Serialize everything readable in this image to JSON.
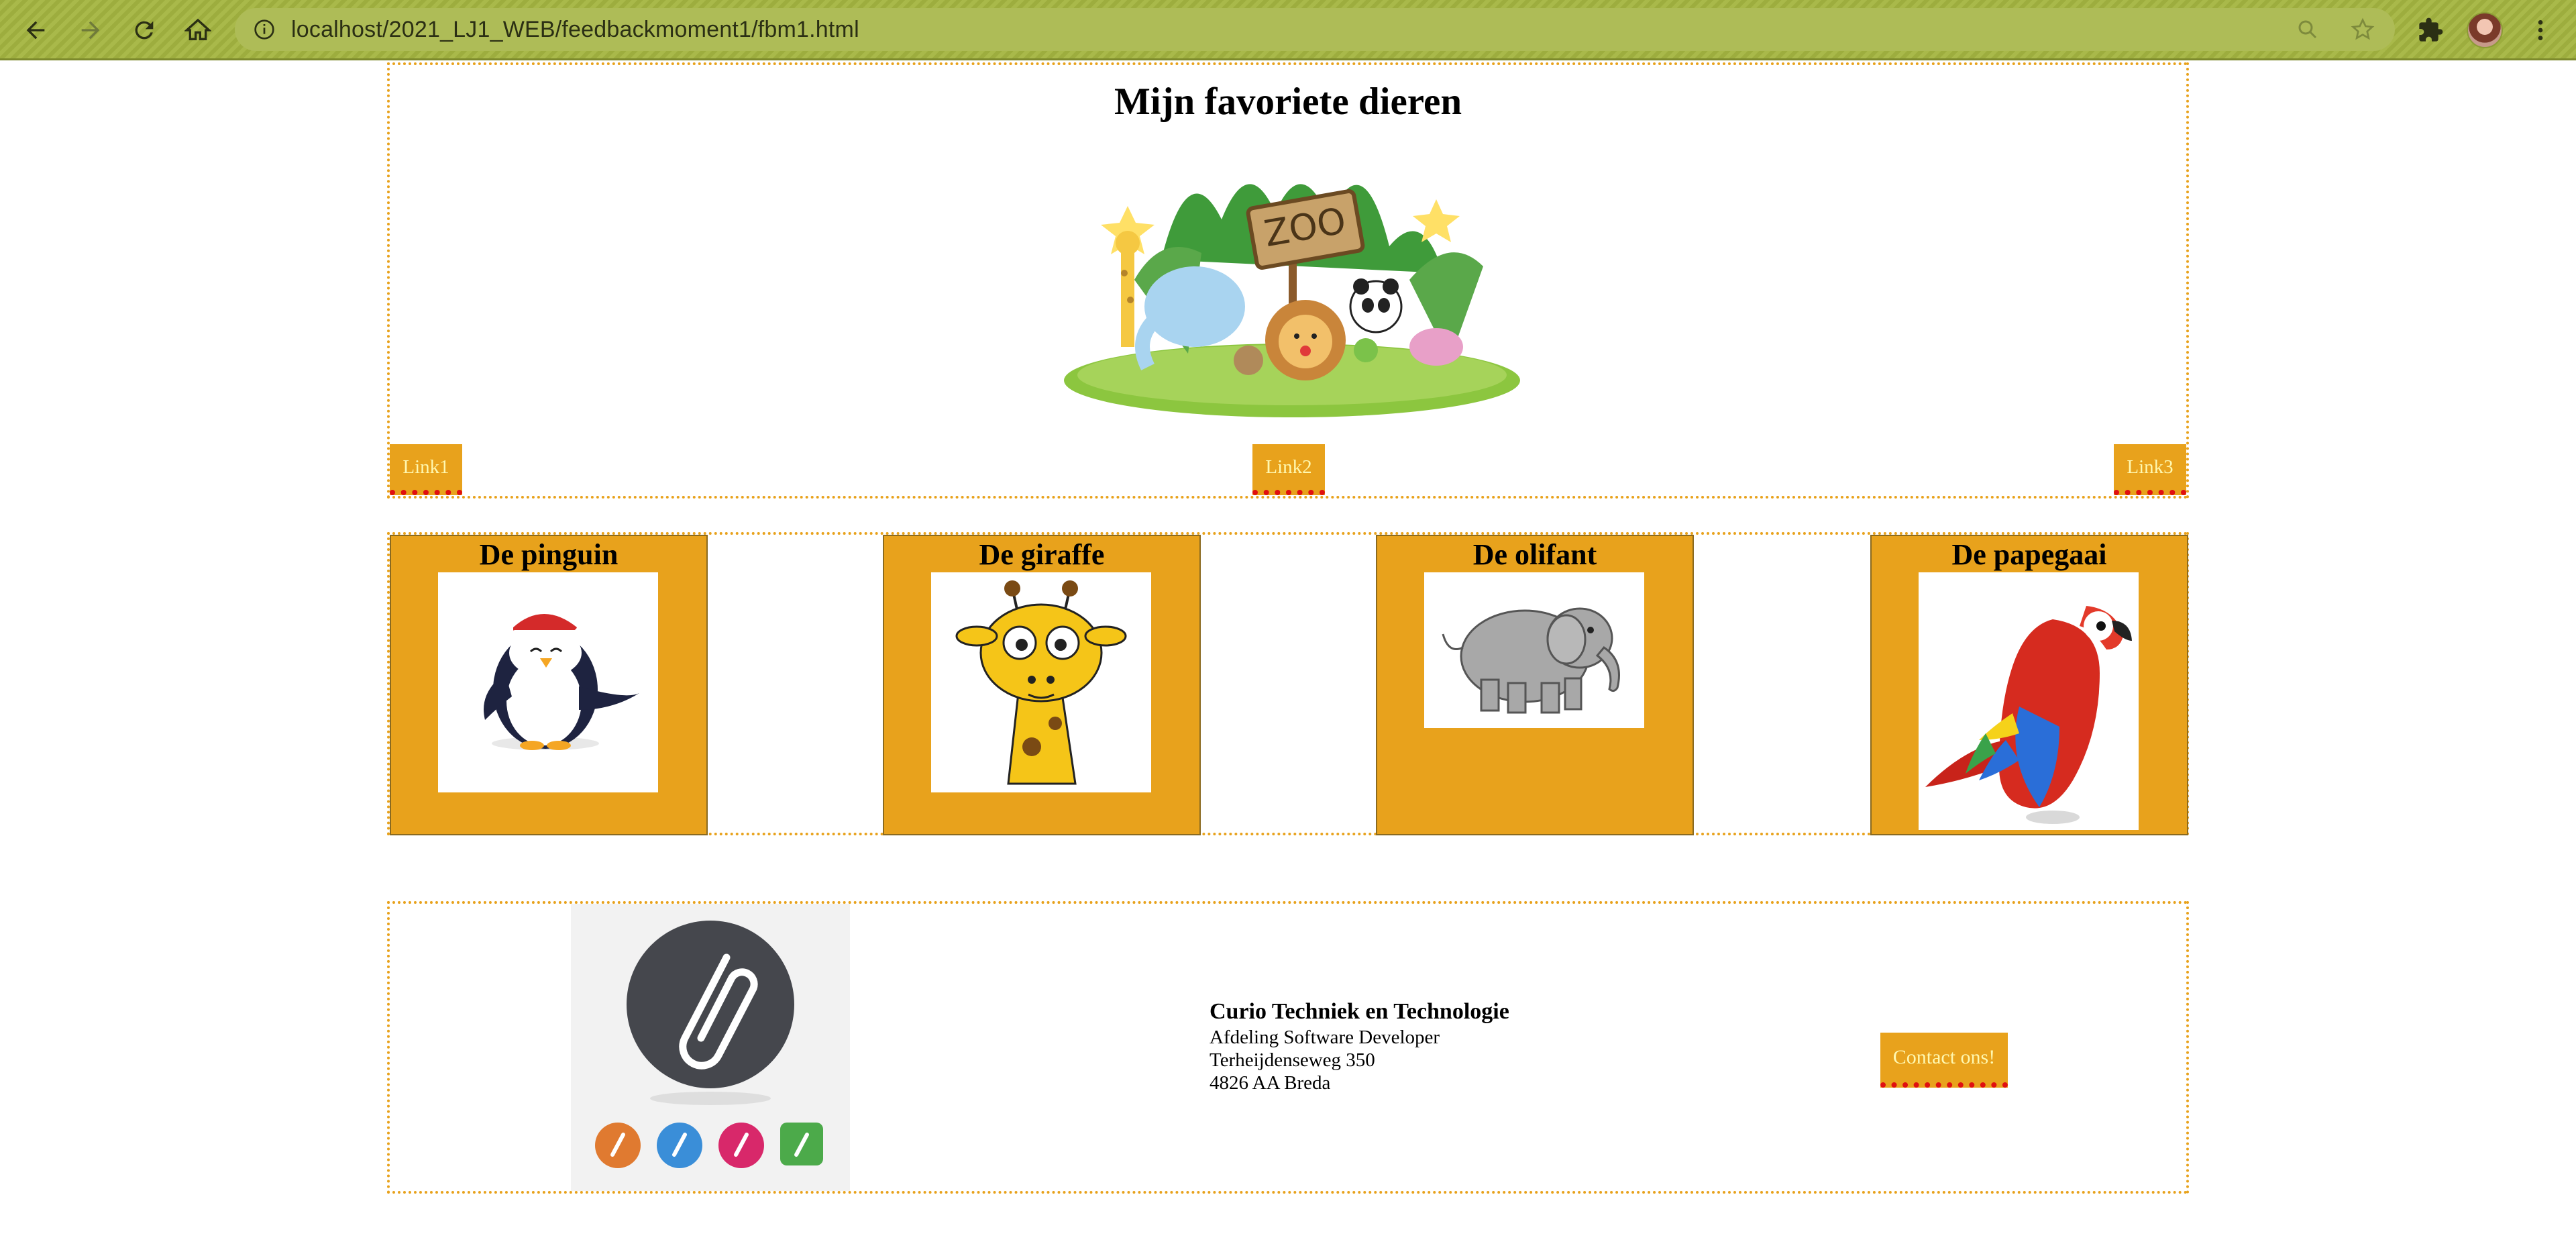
{
  "browser": {
    "url": "localhost/2021_LJ1_WEB/feedbackmoment1/fbm1.html",
    "icons": [
      "back-icon",
      "forward-icon",
      "reload-icon",
      "home-icon",
      "info-icon",
      "zoom-icon",
      "star-icon",
      "extensions-icon",
      "menu-icon"
    ]
  },
  "header": {
    "title": "Mijn favoriete dieren",
    "links": [
      "Link1",
      "Link2",
      "Link3"
    ]
  },
  "animals": [
    {
      "name": "De pinguin"
    },
    {
      "name": "De giraffe"
    },
    {
      "name": "De olifant"
    },
    {
      "name": "De papegaai"
    }
  ],
  "footer": {
    "org": "Curio Techniek en Technologie",
    "department": "Afdeling Software Developer",
    "street": "Terheijdenseweg 350",
    "city": "4826 AA Breda",
    "contact_label": "Contact ons!"
  },
  "colors": {
    "accent": "#e8a21c",
    "link_text": "#fff8b0",
    "link_underline": "#e01010",
    "chrome": "#a9b94a"
  }
}
